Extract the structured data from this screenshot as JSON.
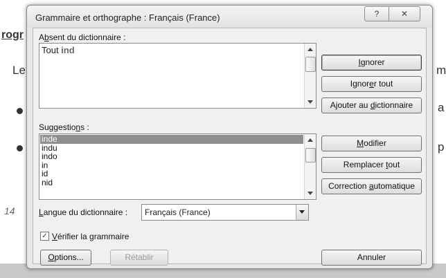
{
  "document": {
    "heading": "rogr",
    "paragraph_start": "Le",
    "right_fragments": [
      "m",
      "a",
      "p"
    ],
    "page_number": "14"
  },
  "dialog": {
    "title": "Grammaire et orthographe : Français (France)",
    "help_glyph": "?",
    "close_glyph": "✕",
    "not_in_dict": {
      "label_pre": "A",
      "label_key": "b",
      "label_post": "sent du dictionnaire :",
      "text_plain": "Tout ",
      "text_error": "ind"
    },
    "suggestions": {
      "label_pre": "Suggestio",
      "label_key": "n",
      "label_post": "s :",
      "items": [
        "inde",
        "indu",
        "indo",
        "in",
        "id",
        "nid"
      ],
      "selected_index": 0
    },
    "buttons": {
      "ignore": {
        "pre": "",
        "key": "I",
        "post": "gnorer"
      },
      "ignore_all": {
        "pre": "Ignor",
        "key": "e",
        "post": "r tout"
      },
      "add_to_dict": {
        "pre": "Ajouter au ",
        "key": "d",
        "post": "ictionnaire"
      },
      "change": {
        "pre": "",
        "key": "M",
        "post": "odifier"
      },
      "change_all": {
        "pre": "Remplacer ",
        "key": "t",
        "post": "out"
      },
      "autocorrect": {
        "pre": "Correction ",
        "key": "a",
        "post": "utomatique"
      },
      "options": {
        "pre": "",
        "key": "O",
        "post": "ptions..."
      },
      "undo": "Rétablir",
      "cancel": "Annuler"
    },
    "language": {
      "label_pre": "",
      "label_key": "L",
      "label_post": "angue du dictionnaire :",
      "value": "Français (France)"
    },
    "check_grammar": {
      "label_pre": "",
      "label_key": "V",
      "label_post": "érifier la grammaire",
      "checked": true,
      "check_glyph": "✓"
    }
  }
}
